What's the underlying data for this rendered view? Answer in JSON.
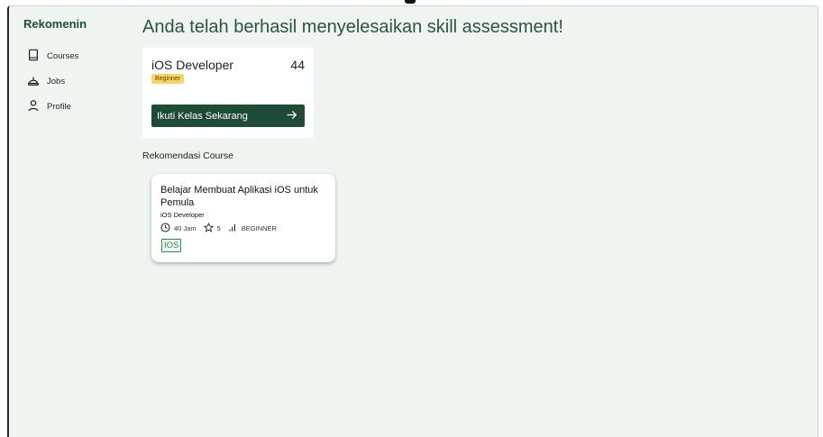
{
  "sidebar": {
    "brand": "Rekomenin",
    "items": [
      {
        "label": "Courses",
        "icon": "book-icon"
      },
      {
        "label": "Jobs",
        "icon": "hard-hat-icon"
      },
      {
        "label": "Profile",
        "icon": "user-icon"
      }
    ]
  },
  "main": {
    "headline": "Anda telah berhasil menyelesaikan skill assessment!",
    "skill_card": {
      "title": "iOS Developer",
      "score": "44",
      "level": "Beginner",
      "cta_label": "Ikuti Kelas Sekarang",
      "cta_icon": "arrow-right-icon"
    },
    "section_label": "Rekomendasi Course",
    "course_card": {
      "title": "Belajar Membuat Aplikasi iOS untuk Pemula",
      "path": "iOS Developer",
      "duration": "40 Jam",
      "rating": "5",
      "level": "BEGINNER",
      "tag": "IOS"
    }
  },
  "colors": {
    "brand_green": "#1d4b35",
    "badge_yellow": "#f9d566",
    "tag_green": "#2e8a4f",
    "background": "#eff4f0"
  }
}
